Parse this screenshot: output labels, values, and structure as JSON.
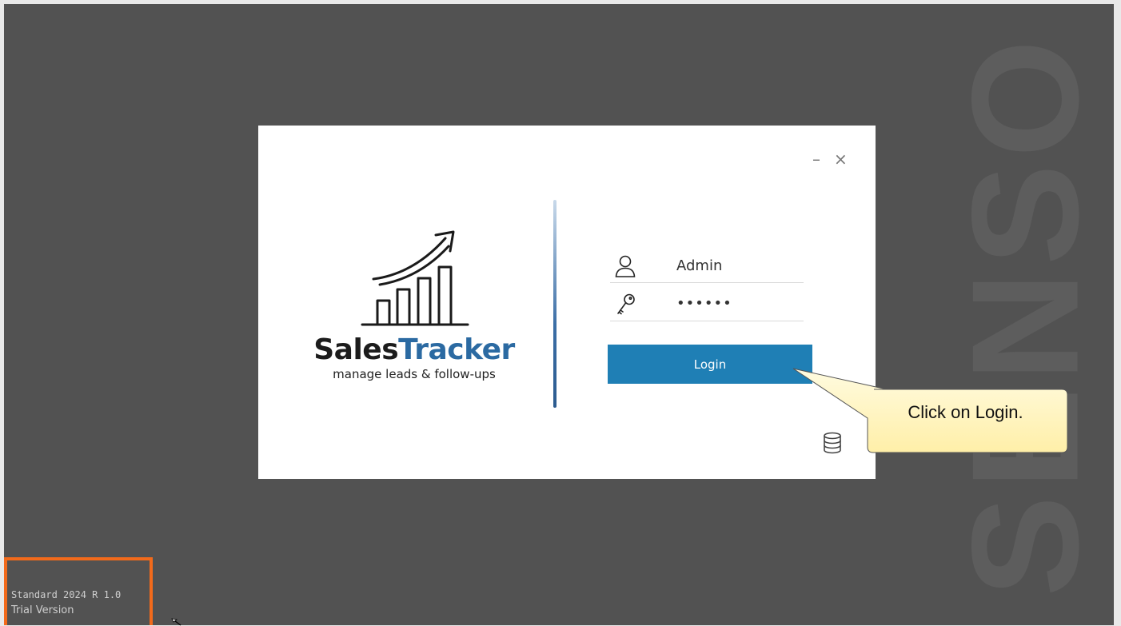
{
  "watermark": {
    "text": "SENSO"
  },
  "dialog": {
    "window_controls": {
      "minimize": "–",
      "close": "×"
    },
    "brand": {
      "name_part1": "Sales",
      "name_part2": "Tracker",
      "tagline": "manage leads & follow-ups"
    },
    "username": {
      "value": "Admin"
    },
    "password": {
      "value": "••••••"
    },
    "login_label": "Login"
  },
  "callout": {
    "text": "Click on Login."
  },
  "version": {
    "line1": "Standard 2024 R 1.0",
    "line2": "Trial Version"
  },
  "colors": {
    "background": "#525252",
    "login_button": "#1f7fb5",
    "brand_accent": "#2b6aa2",
    "highlight_box": "#f26a1b",
    "callout_fill": "#fff6c4"
  },
  "icons": {
    "user": "user-icon",
    "key": "key-icon",
    "database": "database-icon",
    "logo": "growth-chart-logo"
  }
}
